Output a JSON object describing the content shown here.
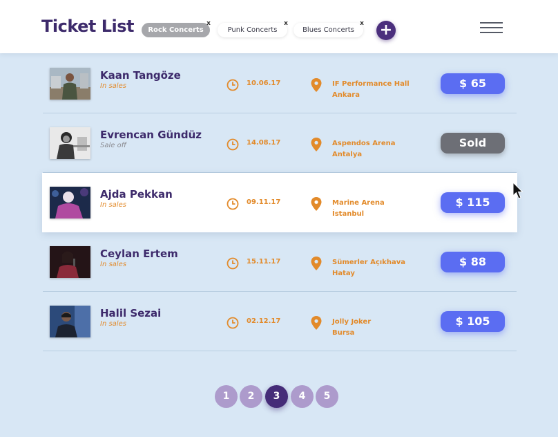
{
  "header": {
    "title": "Ticket List",
    "filters": [
      {
        "label": "Rock Concerts",
        "active": true,
        "close": "x"
      },
      {
        "label": "Punk Concerts",
        "active": false,
        "close": "x"
      },
      {
        "label": "Blues Concerts",
        "active": false,
        "close": "x"
      }
    ],
    "add_label": "+",
    "icons": {
      "add": "plus-icon",
      "menu": "hamburger-menu-icon"
    }
  },
  "tickets": [
    {
      "name": "Kaan Tangöze",
      "status": "In sales",
      "date": "10.06.17",
      "venue": "IF Performance Hall",
      "city": "Ankara",
      "price": "$ 65"
    },
    {
      "name": "Evrencan Gündüz",
      "status": "Sale off",
      "date": "14.08.17",
      "venue": "Aspendos Arena",
      "city": "Antalya",
      "price": "Sold"
    },
    {
      "name": "Ajda Pekkan",
      "status": "In sales",
      "date": "09.11.17",
      "venue": "Marine Arena",
      "city": "İstanbul",
      "price": "$ 115"
    },
    {
      "name": "Ceylan Ertem",
      "status": "In sales",
      "date": "15.11.17",
      "venue": "Sümerler Açıkhava",
      "city": "Hatay",
      "price": "$ 88"
    },
    {
      "name": "Halil Sezai",
      "status": "In sales",
      "date": "02.12.17",
      "venue": "Jolly Joker",
      "city": "Bursa",
      "price": "$ 105"
    }
  ],
  "pagination": {
    "pages": [
      "1",
      "2",
      "3",
      "4",
      "5"
    ],
    "current": "3"
  },
  "colors": {
    "primary": "#3d2a6b",
    "accent": "#e28a2a",
    "button": "#5b6df2",
    "sold": "#6d6f76",
    "background": "#d8e7f5"
  }
}
